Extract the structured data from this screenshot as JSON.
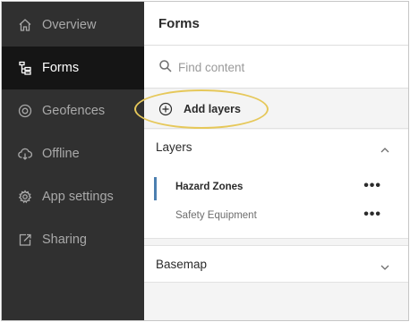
{
  "sidebar": {
    "items": [
      {
        "label": "Overview",
        "icon": "home-icon"
      },
      {
        "label": "Forms",
        "icon": "forms-icon"
      },
      {
        "label": "Geofences",
        "icon": "geofence-icon"
      },
      {
        "label": "Offline",
        "icon": "offline-icon"
      },
      {
        "label": "App settings",
        "icon": "gear-icon"
      },
      {
        "label": "Sharing",
        "icon": "share-icon"
      }
    ],
    "active": "Forms"
  },
  "header": {
    "title": "Forms"
  },
  "search": {
    "placeholder": "Find content",
    "value": ""
  },
  "add_layers": {
    "label": "Add layers"
  },
  "layers": {
    "title": "Layers",
    "items": [
      {
        "name": "Hazard Zones",
        "selected": true
      },
      {
        "name": "Safety Equipment",
        "selected": false
      }
    ]
  },
  "basemap": {
    "title": "Basemap"
  },
  "colors": {
    "sidebar_bg": "#303030",
    "sidebar_active_bg": "#151515",
    "accent": "#4c7fb0",
    "highlight": "#e6c85a"
  }
}
